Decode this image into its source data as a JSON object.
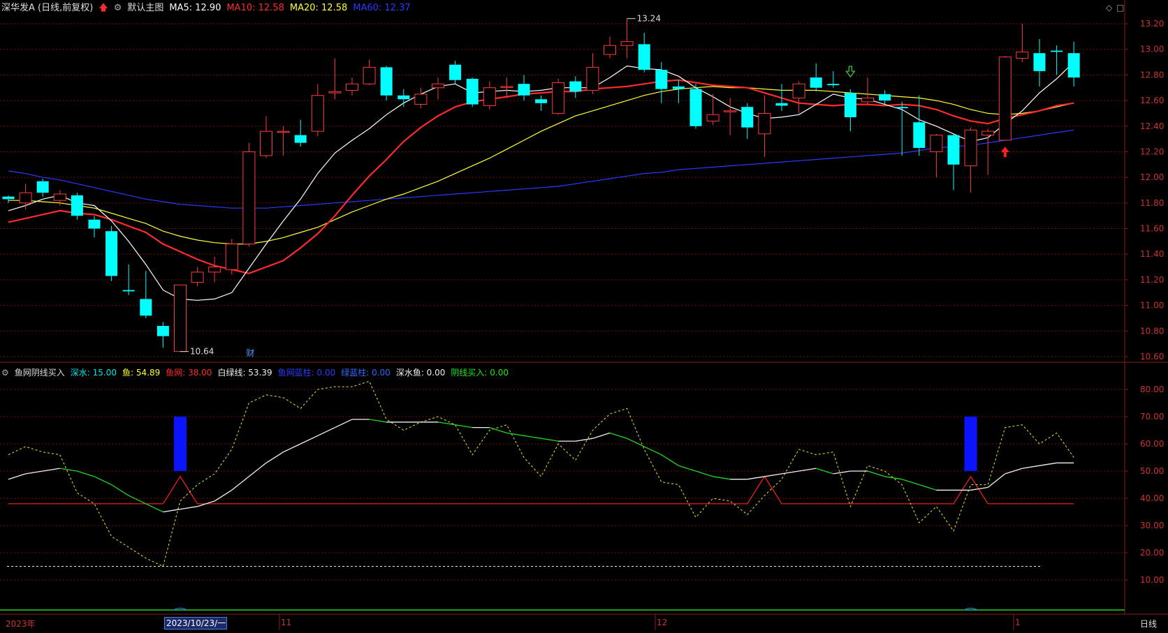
{
  "main_header": {
    "stock": "深华发A (日线,前复权)",
    "main_indicator": "默认主图",
    "ma5": "MA5: 12.90",
    "ma10": "MA10: 12.58",
    "ma20": "MA20: 12.58",
    "ma60": "MA60: 12.37",
    "colors": {
      "ma5": "#ffffff",
      "ma10": "#ff2b2b",
      "ma20": "#ffff33",
      "ma60": "#2a3aff"
    }
  },
  "sub_header": {
    "indicator": "鱼网阴线买入",
    "shenshui": "深水: 15.00",
    "yu": "鱼: 54.89",
    "yuwang": "鱼网: 38.00",
    "bailv": "白绿线: 53.39",
    "yuwang_lanzhu": "鱼网蓝柱: 0.00",
    "lvlanzhu": "绿蓝柱: 0.00",
    "shenshuiyu": "深水鱼: 0.00",
    "yinxian": "阴线买入: 0.00"
  },
  "annotations": {
    "high": "13.24",
    "low": "10.64",
    "cai": "财"
  },
  "x_axis": {
    "year": "2023年",
    "cursor_date": "2023/10/23/一",
    "m11": "11",
    "m12": "12",
    "m1": "1",
    "period": "日线"
  },
  "price_axis": [
    "13.20",
    "13.00",
    "12.80",
    "12.60",
    "12.40",
    "12.20",
    "12.00",
    "11.80",
    "11.60",
    "11.40",
    "11.20",
    "11.00",
    "10.80",
    "10.60"
  ],
  "sub_axis": [
    "80.00",
    "70.00",
    "60.00",
    "50.00",
    "40.00",
    "30.00",
    "20.00",
    "10.00"
  ],
  "candles": [
    [
      11.85,
      11.83,
      11.86,
      11.8
    ],
    [
      11.8,
      11.88,
      11.95,
      11.75
    ],
    [
      11.97,
      11.88,
      11.99,
      11.85
    ],
    [
      11.82,
      11.87,
      11.9,
      11.78
    ],
    [
      11.86,
      11.7,
      11.88,
      11.67
    ],
    [
      11.67,
      11.6,
      11.7,
      11.53
    ],
    [
      11.58,
      11.23,
      11.62,
      11.19
    ],
    [
      11.12,
      11.11,
      11.32,
      11.08
    ],
    [
      11.05,
      10.92,
      11.27,
      10.9
    ],
    [
      10.84,
      10.76,
      10.87,
      10.67
    ],
    [
      10.64,
      11.16,
      11.16,
      10.64
    ],
    [
      11.18,
      11.26,
      11.3,
      11.15
    ],
    [
      11.26,
      11.3,
      11.38,
      11.18
    ],
    [
      11.28,
      11.48,
      11.52,
      11.24
    ],
    [
      11.48,
      12.2,
      12.27,
      11.46
    ],
    [
      12.17,
      12.36,
      12.48,
      12.15
    ],
    [
      12.36,
      12.36,
      12.4,
      12.17
    ],
    [
      12.33,
      12.27,
      12.45,
      12.24
    ],
    [
      12.36,
      12.64,
      12.73,
      12.32
    ],
    [
      12.66,
      12.67,
      12.93,
      12.61
    ],
    [
      12.68,
      12.73,
      12.78,
      12.64
    ],
    [
      12.73,
      12.86,
      12.92,
      12.72
    ],
    [
      12.86,
      12.64,
      12.87,
      12.6
    ],
    [
      12.64,
      12.61,
      12.69,
      12.55
    ],
    [
      12.57,
      12.65,
      12.7,
      12.54
    ],
    [
      12.7,
      12.73,
      12.78,
      12.61
    ],
    [
      12.88,
      12.76,
      12.91,
      12.73
    ],
    [
      12.77,
      12.57,
      12.78,
      12.55
    ],
    [
      12.56,
      12.7,
      12.75,
      12.53
    ],
    [
      12.71,
      12.71,
      12.78,
      12.62
    ],
    [
      12.73,
      12.64,
      12.8,
      12.6
    ],
    [
      12.61,
      12.58,
      12.64,
      12.52
    ],
    [
      12.5,
      12.74,
      12.77,
      12.49
    ],
    [
      12.75,
      12.67,
      12.79,
      12.62
    ],
    [
      12.68,
      12.86,
      12.97,
      12.65
    ],
    [
      12.96,
      13.03,
      13.1,
      12.93
    ],
    [
      13.03,
      13.06,
      13.24,
      12.93
    ],
    [
      13.04,
      12.84,
      13.13,
      12.82
    ],
    [
      12.84,
      12.69,
      12.9,
      12.58
    ],
    [
      12.71,
      12.69,
      12.76,
      12.58
    ],
    [
      12.69,
      12.4,
      12.73,
      12.38
    ],
    [
      12.44,
      12.49,
      12.65,
      12.41
    ],
    [
      12.52,
      12.52,
      12.62,
      12.33
    ],
    [
      12.55,
      12.39,
      12.58,
      12.3
    ],
    [
      12.34,
      12.5,
      12.64,
      12.16
    ],
    [
      12.58,
      12.56,
      12.73,
      12.52
    ],
    [
      12.62,
      12.73,
      12.75,
      12.5
    ],
    [
      12.78,
      12.7,
      12.89,
      12.67
    ],
    [
      12.73,
      12.72,
      12.83,
      12.7
    ],
    [
      12.66,
      12.47,
      12.69,
      12.36
    ],
    [
      12.59,
      12.62,
      12.78,
      12.57
    ],
    [
      12.65,
      12.6,
      12.68,
      12.57
    ],
    [
      12.55,
      12.54,
      12.59,
      12.17
    ],
    [
      12.43,
      12.23,
      12.64,
      12.17
    ],
    [
      12.2,
      12.33,
      12.34,
      12.0
    ],
    [
      12.33,
      12.1,
      12.34,
      11.9
    ],
    [
      12.09,
      12.37,
      12.39,
      11.88
    ],
    [
      12.33,
      12.36,
      12.38,
      12.02
    ],
    [
      12.29,
      12.94,
      12.95,
      12.29
    ],
    [
      12.93,
      12.98,
      13.2,
      12.9
    ],
    [
      12.97,
      12.83,
      13.08,
      12.71
    ],
    [
      12.99,
      12.98,
      13.03,
      12.8
    ],
    [
      12.97,
      12.78,
      13.06,
      12.71
    ]
  ],
  "ma5": [
    11.74,
    11.78,
    11.83,
    11.86,
    11.8,
    11.78,
    11.66,
    11.5,
    11.32,
    11.12,
    11.05,
    11.04,
    11.05,
    11.1,
    11.29,
    11.48,
    11.66,
    11.83,
    12.03,
    12.19,
    12.29,
    12.38,
    12.49,
    12.58,
    12.65,
    12.71,
    12.73,
    12.66,
    12.67,
    12.68,
    12.67,
    12.68,
    12.7,
    12.7,
    12.7,
    12.78,
    12.87,
    12.85,
    12.84,
    12.79,
    12.7,
    12.63,
    12.55,
    12.5,
    12.46,
    12.47,
    12.49,
    12.57,
    12.65,
    12.62,
    12.61,
    12.57,
    12.53,
    12.45,
    12.4,
    12.34,
    12.28,
    12.31,
    12.42,
    12.52,
    12.66,
    12.77,
    12.9
  ],
  "ma10": [
    11.65,
    11.68,
    11.71,
    11.74,
    11.72,
    11.71,
    11.67,
    11.62,
    11.57,
    11.48,
    11.42,
    11.36,
    11.31,
    11.28,
    11.25,
    11.3,
    11.35,
    11.45,
    11.56,
    11.7,
    11.86,
    12.01,
    12.14,
    12.28,
    12.39,
    12.48,
    12.55,
    12.59,
    12.61,
    12.63,
    12.65,
    12.66,
    12.67,
    12.67,
    12.69,
    12.7,
    12.71,
    12.73,
    12.75,
    12.76,
    12.74,
    12.72,
    12.71,
    12.7,
    12.66,
    12.62,
    12.58,
    12.57,
    12.56,
    12.57,
    12.57,
    12.56,
    12.57,
    12.56,
    12.53,
    12.48,
    12.44,
    12.42,
    12.46,
    12.49,
    12.52,
    12.56,
    12.58
  ],
  "ma20": [
    11.82,
    11.82,
    11.81,
    11.8,
    11.78,
    11.76,
    11.72,
    11.68,
    11.64,
    11.58,
    11.54,
    11.51,
    11.49,
    11.48,
    11.48,
    11.5,
    11.53,
    11.57,
    11.61,
    11.67,
    11.73,
    11.78,
    11.83,
    11.87,
    11.92,
    11.97,
    12.03,
    12.09,
    12.15,
    12.22,
    12.29,
    12.36,
    12.42,
    12.48,
    12.52,
    12.56,
    12.6,
    12.64,
    12.67,
    12.69,
    12.7,
    12.71,
    12.7,
    12.7,
    12.69,
    12.68,
    12.68,
    12.68,
    12.67,
    12.66,
    12.65,
    12.64,
    12.63,
    12.62,
    12.6,
    12.57,
    12.53,
    12.5,
    12.49,
    12.5,
    12.52,
    12.55,
    12.58
  ],
  "ma60": [
    12.05,
    12.03,
    12.0,
    11.98,
    11.95,
    11.92,
    11.89,
    11.86,
    11.83,
    11.81,
    11.79,
    11.78,
    11.77,
    11.76,
    11.76,
    11.76,
    11.77,
    11.78,
    11.79,
    11.8,
    11.81,
    11.82,
    11.83,
    11.84,
    11.85,
    11.86,
    11.87,
    11.88,
    11.89,
    11.9,
    11.91,
    11.92,
    11.93,
    11.95,
    11.97,
    11.99,
    12.01,
    12.03,
    12.04,
    12.06,
    12.07,
    12.08,
    12.09,
    12.1,
    12.11,
    12.12,
    12.13,
    12.14,
    12.15,
    12.16,
    12.17,
    12.18,
    12.19,
    12.21,
    12.23,
    12.24,
    12.25,
    12.27,
    12.29,
    12.31,
    12.33,
    12.35,
    12.37
  ],
  "sub_yellow": [
    56,
    59,
    57,
    56,
    42,
    38,
    26,
    22,
    18,
    15,
    39,
    45,
    49,
    58,
    75,
    78,
    77,
    73,
    80,
    81,
    81,
    83,
    69,
    65,
    68,
    70,
    67,
    56,
    65,
    67,
    55,
    48,
    60,
    54,
    65,
    71,
    73,
    58,
    46,
    45,
    33,
    40,
    39,
    34,
    41,
    47,
    58,
    56,
    57,
    37,
    52,
    50,
    45,
    31,
    37,
    28,
    45,
    45,
    66,
    67,
    60,
    64,
    55
  ],
  "sub_white": [
    47,
    49,
    50,
    51,
    50,
    48,
    45,
    41,
    38,
    35,
    36,
    37,
    39,
    43,
    48,
    53,
    57,
    60,
    63,
    66,
    69,
    69,
    68,
    68,
    68,
    68,
    67,
    66,
    66,
    64,
    63,
    62,
    61,
    61,
    62,
    64,
    62,
    59,
    56,
    52,
    50,
    48,
    47,
    47,
    48,
    49,
    50,
    51,
    49,
    50,
    50,
    48,
    47,
    45,
    43,
    43,
    43,
    44,
    49,
    51,
    52,
    53,
    53
  ],
  "sub_red": [
    38,
    38,
    38,
    38,
    38,
    38,
    38,
    38,
    38,
    38,
    48,
    38,
    38,
    38,
    38,
    38,
    38,
    38,
    38,
    38,
    38,
    38,
    38,
    38,
    38,
    38,
    38,
    38,
    38,
    38,
    38,
    38,
    38,
    38,
    38,
    38,
    38,
    38,
    38,
    38,
    38,
    38,
    38,
    38,
    48,
    38,
    38,
    38,
    38,
    38,
    38,
    38,
    38,
    38,
    38,
    38,
    48,
    38,
    38,
    38,
    38,
    38,
    38
  ],
  "blue_bars": [
    10,
    56
  ],
  "shenshui_level": 15,
  "markers": {
    "buy_arrow_at": 58,
    "sell_arrow_at": 49
  }
}
